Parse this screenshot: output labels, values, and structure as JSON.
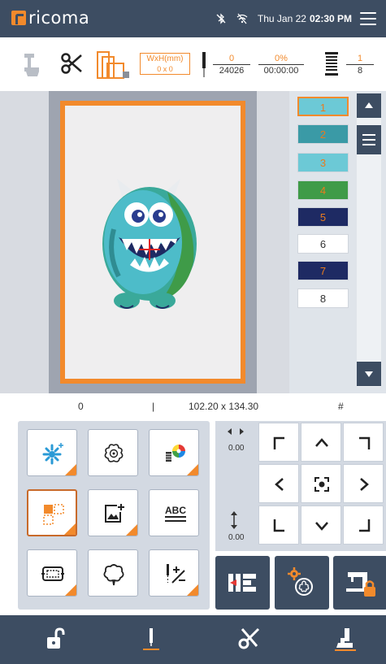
{
  "app": {
    "brand": "ricoma"
  },
  "status": {
    "bluetooth_icon": "bluetooth-off-icon",
    "wifi_icon": "wifi-off-icon",
    "date": "Thu Jan 22",
    "time": "02:30 PM"
  },
  "toolbar": {
    "size_label": "WxH(mm)",
    "size_value": "0 x 0",
    "stitch_current": "0",
    "stitch_total": "24026",
    "progress_percent": "0%",
    "progress_time": "00:00:00",
    "color_current": "1",
    "color_total": "8"
  },
  "colors": [
    {
      "label": "1",
      "bg": "#6cc9d6",
      "fg": "#e87b1f",
      "selected": true
    },
    {
      "label": "2",
      "bg": "#3a9aa6",
      "fg": "#e87b1f"
    },
    {
      "label": "3",
      "bg": "#6cc9d6",
      "fg": "#e87b1f"
    },
    {
      "label": "4",
      "bg": "#3f9b48",
      "fg": "#e87b1f"
    },
    {
      "label": "5",
      "bg": "#1e2a63",
      "fg": "#e87b1f"
    },
    {
      "label": "6",
      "bg": "#ffffff",
      "fg": "#333333"
    },
    {
      "label": "7",
      "bg": "#1e2a63",
      "fg": "#e87b1f"
    },
    {
      "label": "8",
      "bg": "#ffffff",
      "fg": "#333333"
    }
  ],
  "info": {
    "left": "0",
    "separator": "|",
    "dimensions": "102.20 x 134.30",
    "hash": "#"
  },
  "jog": {
    "x_value": "0.00",
    "y_value": "0.00"
  },
  "tools": [
    {
      "icon": "add-design-icon"
    },
    {
      "icon": "flower-edit-icon"
    },
    {
      "icon": "thread-color-icon"
    },
    {
      "icon": "select-layout-icon"
    },
    {
      "icon": "add-image-icon"
    },
    {
      "icon": "text-abc-icon",
      "text": "ABC"
    },
    {
      "icon": "hoop-frame-icon"
    },
    {
      "icon": "outline-shape-icon"
    },
    {
      "icon": "stitch-edit-icon"
    }
  ],
  "actions": [
    {
      "icon": "trace-frame-icon"
    },
    {
      "icon": "design-settings-icon"
    },
    {
      "icon": "machine-lock-icon"
    }
  ],
  "bottom_nav": [
    {
      "icon": "unlock-icon"
    },
    {
      "icon": "needle-icon"
    },
    {
      "icon": "trim-scissors-icon"
    },
    {
      "icon": "presser-foot-icon"
    }
  ],
  "palette": {
    "accent": "#f28a2c",
    "navy": "#3d4d62"
  }
}
